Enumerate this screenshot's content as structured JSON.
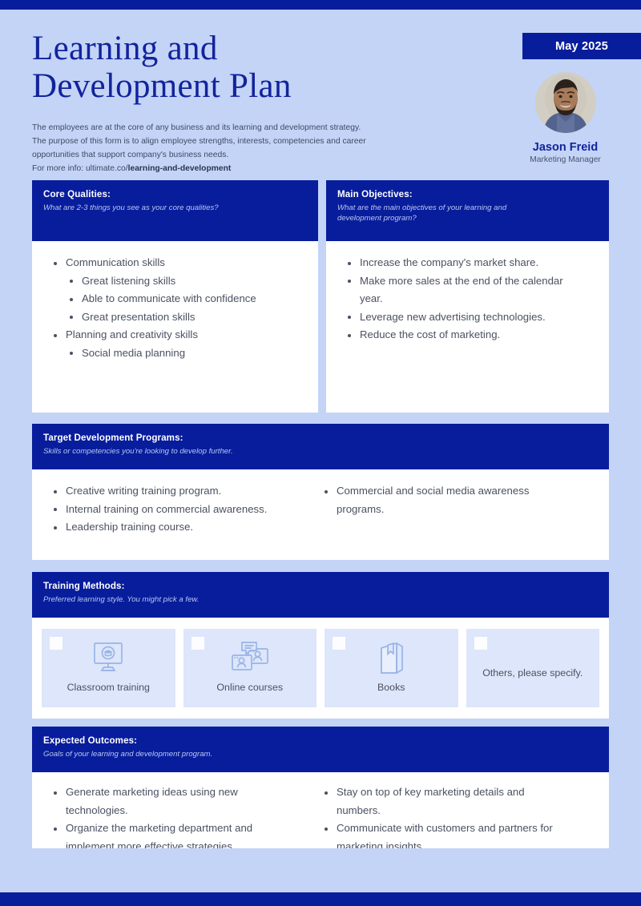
{
  "colors": {
    "page_bg": "#c3d4f7",
    "brand_blue": "#081d9c",
    "title_blue": "#13239c",
    "body_text": "#4b5162",
    "card_bg": "#dde6fa"
  },
  "header": {
    "title": "Learning and Development Plan",
    "date_badge": "May 2025",
    "intro_line1": "The employees are at the core of any business and its learning and development strategy.",
    "intro_line2": "The purpose of this form is to align employee strengths, interests, competencies and career",
    "intro_line3": "opportunities that support company's business needs.",
    "more_info_prefix": "For more info: ultimate.co/",
    "more_info_bold": "learning-and-development",
    "profile": {
      "name": "Jason Freid",
      "role": "Marketing Manager"
    }
  },
  "sections": {
    "core_qualities": {
      "title": "Core Qualities:",
      "subtitle": "What are 2-3 things you see as your core qualities?",
      "items": [
        {
          "text": "Communication skills",
          "children": [
            "Great listening skills",
            "Able to communicate with confidence",
            "Great presentation skills"
          ]
        },
        {
          "text": "Planning and creativity skills",
          "children": [
            "Social media planning"
          ]
        }
      ]
    },
    "main_objectives": {
      "title": "Main Objectives:",
      "subtitle": "What are the main objectives of your learning and development program?",
      "items": [
        "Increase the company's market share.",
        "Make more sales at the end of the calendar year.",
        "Leverage new advertising technologies.",
        "Reduce the cost of marketing."
      ]
    },
    "target_programs": {
      "title": "Target Development Programs:",
      "subtitle": "Skills or competencies you're looking to develop further.",
      "items_left": [
        "Creative writing training program.",
        "Internal training on commercial awareness.",
        "Leadership training course."
      ],
      "items_right": [
        "Commercial and social media awareness programs."
      ]
    },
    "training_methods": {
      "title": "Training Methods:",
      "subtitle": "Preferred learning style. You might pick a few.",
      "options": [
        {
          "label": "Classroom training",
          "icon": "monitor-graduation-cap-icon",
          "checked": false
        },
        {
          "label": "Online courses",
          "icon": "video-call-people-icon",
          "checked": false
        },
        {
          "label": "Books",
          "icon": "book-bookmark-icon",
          "checked": false
        },
        {
          "label": "Others, please specify.",
          "icon": "none",
          "checked": false
        }
      ]
    },
    "expected_outcomes": {
      "title": "Expected Outcomes:",
      "subtitle": "Goals of your learning and development program.",
      "items_left": [
        "Generate marketing ideas using new technologies.",
        "Organize the marketing department and implement more effective strategies."
      ],
      "items_right": [
        "Stay on top of key marketing details and numbers.",
        "Communicate with customers and partners for marketing insights."
      ]
    }
  }
}
